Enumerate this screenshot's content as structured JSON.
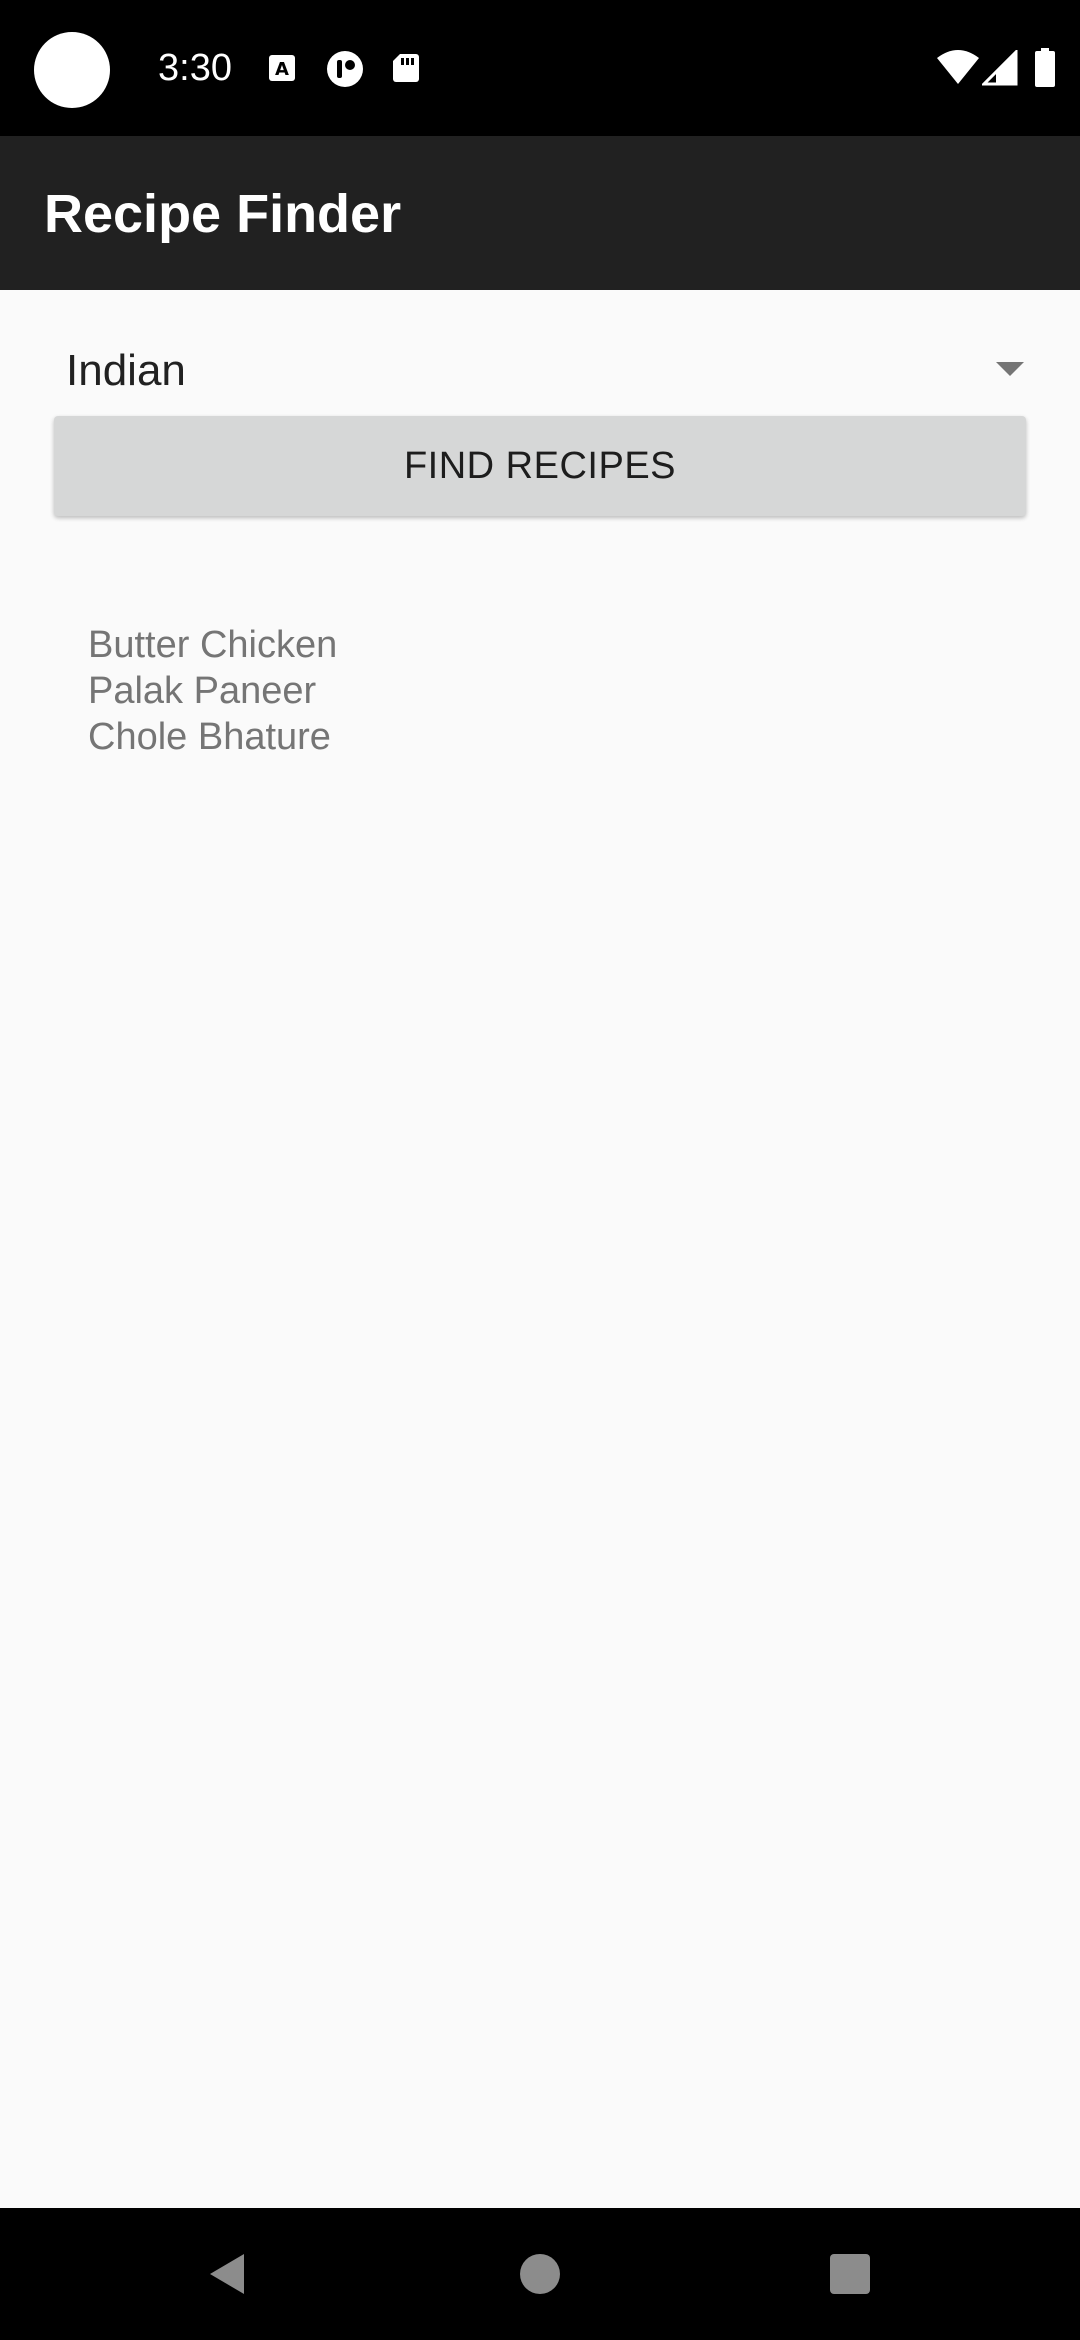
{
  "status_bar": {
    "time": "3:30",
    "left_icons": [
      "a-notification-icon",
      "circle-notification-icon",
      "sd-card-icon"
    ],
    "right_icons": [
      "wifi-icon",
      "cell-signal-icon",
      "battery-icon"
    ]
  },
  "app_bar": {
    "title": "Recipe Finder"
  },
  "cuisine_spinner": {
    "selected": "Indian"
  },
  "find_button": {
    "label": "FIND RECIPES"
  },
  "results": {
    "items": [
      "Butter Chicken",
      "Palak Paneer",
      "Chole Bhature"
    ]
  },
  "nav_bar": {
    "buttons": [
      "back-icon",
      "home-icon",
      "recents-icon"
    ]
  },
  "colors": {
    "status_bar_bg": "#000000",
    "app_bar_bg": "#212121",
    "content_bg": "#fafafa",
    "button_bg": "#d6d7d7",
    "result_text": "#757575"
  }
}
